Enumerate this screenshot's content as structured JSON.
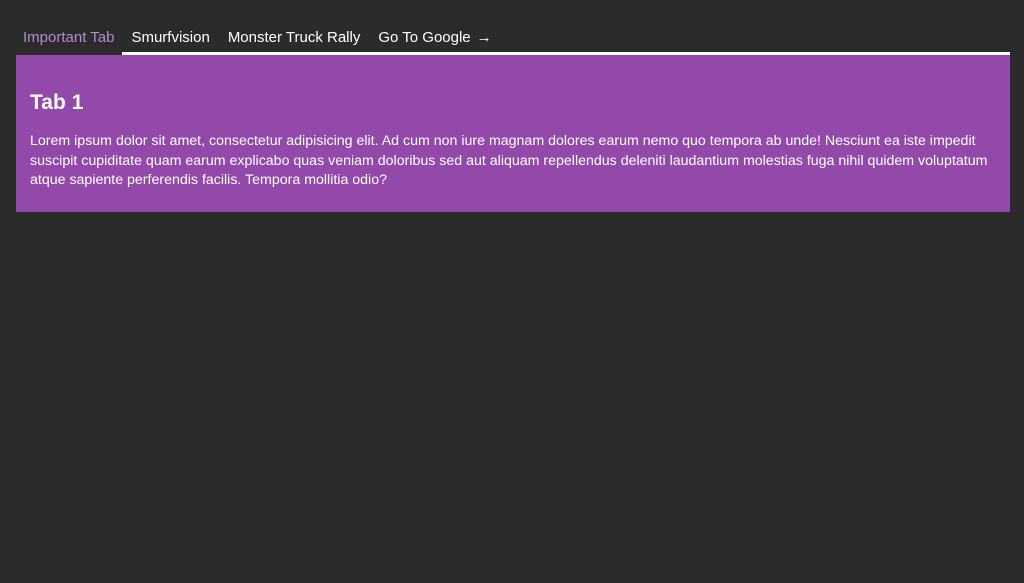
{
  "tabs": [
    {
      "label": "Important Tab",
      "active": true
    },
    {
      "label": "Smurfvision",
      "active": false
    },
    {
      "label": "Monster Truck Rally",
      "active": false
    },
    {
      "label": "Go To Google",
      "active": false,
      "icon": "arrow-right-icon",
      "icon_glyph": "→"
    }
  ],
  "panel": {
    "title": "Tab 1",
    "body": "Lorem ipsum dolor sit amet, consectetur adipisicing elit. Ad cum non iure magnam dolores earum nemo quo tempora ab unde! Nesciunt ea iste impedit suscipit cupiditate quam earum explicabo quas veniam doloribus sed aut aliquam repellendus deleniti laudantium molestias fuga nihil quidem voluptatum atque sapiente perferendis facilis. Tempora mollitia odio?"
  },
  "colors": {
    "background": "#2b2b2b",
    "panel": "#9249a9",
    "active_tab_text": "#b28ad3",
    "tab_text": "#ffffff",
    "underline": "#ffffff"
  }
}
